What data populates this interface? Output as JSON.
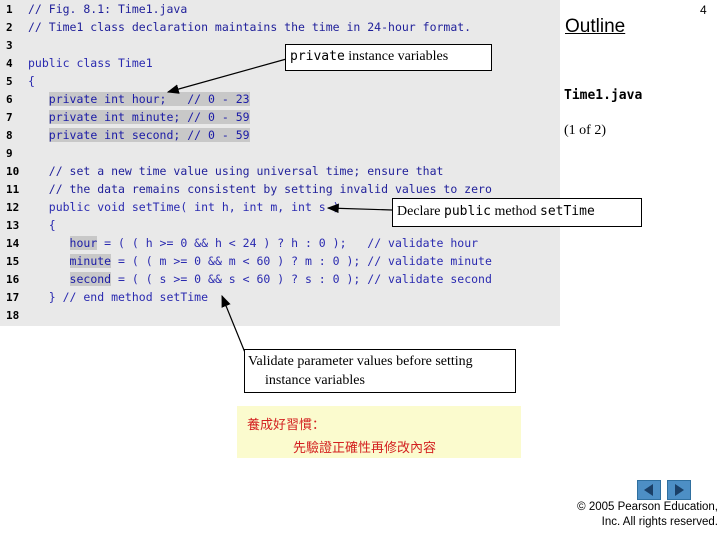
{
  "slide": {
    "outline_label": "Outline",
    "page_number": "4",
    "filename": "Time1.java",
    "part_label": "(1 of 2)"
  },
  "code_lines": [
    {
      "num": "1",
      "segments": [
        {
          "t": "// Fig. 8.1: Time1.java",
          "c": "comment"
        }
      ]
    },
    {
      "num": "2",
      "segments": [
        {
          "t": "// Time1 class declaration maintains the time in 24-hour format.",
          "c": "comment"
        }
      ]
    },
    {
      "num": "3",
      "segments": []
    },
    {
      "num": "4",
      "segments": [
        {
          "t": "public class Time1",
          "c": "code"
        }
      ]
    },
    {
      "num": "5",
      "segments": [
        {
          "t": "{",
          "c": "code"
        }
      ]
    },
    {
      "num": "6",
      "segments": [
        {
          "t": "   ",
          "c": "code"
        },
        {
          "t": "private int hour;   // 0 - 23",
          "c": "hl"
        }
      ]
    },
    {
      "num": "7",
      "segments": [
        {
          "t": "   ",
          "c": "code"
        },
        {
          "t": "private int minute; // 0 - 59",
          "c": "hl"
        }
      ]
    },
    {
      "num": "8",
      "segments": [
        {
          "t": "   ",
          "c": "code"
        },
        {
          "t": "private int second; // 0 - 59",
          "c": "hl"
        }
      ]
    },
    {
      "num": "9",
      "segments": []
    },
    {
      "num": "10",
      "segments": [
        {
          "t": "   // set a new time value using universal time; ensure that",
          "c": "comment"
        }
      ]
    },
    {
      "num": "11",
      "segments": [
        {
          "t": "   // the data remains consistent by setting invalid values to zero",
          "c": "comment"
        }
      ]
    },
    {
      "num": "12",
      "segments": [
        {
          "t": "   public void setTime( int h, int m, int s )",
          "c": "code"
        }
      ]
    },
    {
      "num": "13",
      "segments": [
        {
          "t": "   {",
          "c": "code"
        }
      ]
    },
    {
      "num": "14",
      "segments": [
        {
          "t": "      ",
          "c": "code"
        },
        {
          "t": "hour",
          "c": "hl"
        },
        {
          "t": " = ( ( h >= 0 && h < 24 ) ? h : 0 );   // validate hour",
          "c": "code"
        }
      ]
    },
    {
      "num": "15",
      "segments": [
        {
          "t": "      ",
          "c": "code"
        },
        {
          "t": "minute",
          "c": "hl"
        },
        {
          "t": " = ( ( m >= 0 && m < 60 ) ? m : 0 ); // validate minute",
          "c": "code"
        }
      ]
    },
    {
      "num": "16",
      "segments": [
        {
          "t": "      ",
          "c": "code"
        },
        {
          "t": "second",
          "c": "hl"
        },
        {
          "t": " = ( ( s >= 0 && s < 60 ) ? s : 0 ); // validate second",
          "c": "code"
        }
      ]
    },
    {
      "num": "17",
      "segments": [
        {
          "t": "   } // end method setTime",
          "c": "code"
        }
      ]
    },
    {
      "num": "18",
      "segments": []
    }
  ],
  "callouts": {
    "private_vars": {
      "code": "private",
      "text": " instance variables"
    },
    "declare_method": {
      "pre": "Declare ",
      "code1": "public",
      "mid": " method ",
      "code2": "setTime"
    },
    "validate": {
      "line1": "Validate parameter values before setting",
      "line2": "instance variables"
    }
  },
  "note": {
    "line1": "養成好習慣：",
    "line2": "先驗證正確性再修改內容"
  },
  "footer": {
    "copyright_line1": "© 2005 Pearson Education,",
    "copyright_line2": "Inc.  All rights reserved."
  },
  "colors": {
    "code_background": "#e9e9e9",
    "note_background": "#fbfbce",
    "note_text": "#d32020",
    "nav_button": "#4d8fc5"
  }
}
